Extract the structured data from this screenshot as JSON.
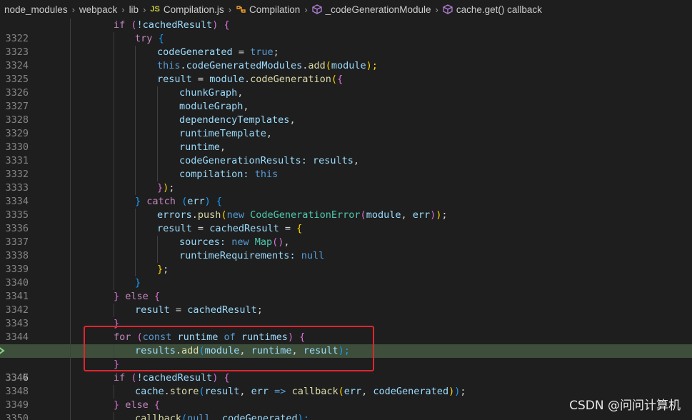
{
  "breadcrumb": {
    "items": [
      "node_modules",
      "webpack",
      "lib",
      "Compilation.js",
      "Compilation",
      "_codeGenerationModule",
      "cache.get() callback"
    ],
    "js_badge": "JS"
  },
  "editor": {
    "active_line": "3346",
    "highlight_color": "#3d4f3a",
    "annotation_box_color": "#e0262e",
    "line_numbers": [
      "3322",
      "3323",
      "3324",
      "3325",
      "3326",
      "3327",
      "3328",
      "3329",
      "3330",
      "3331",
      "3332",
      "3333",
      "3334",
      "3335",
      "3336",
      "3337",
      "3338",
      "3339",
      "3340",
      "3341",
      "3342",
      "3343",
      "3344",
      "3345",
      "3346",
      "3347",
      "3348",
      "3349",
      "3350",
      "3351"
    ],
    "tokens": {
      "l3322": [
        "if",
        "(",
        "!cachedResult",
        ")",
        "{"
      ],
      "l3323": [
        "try",
        "{"
      ],
      "l3324": [
        "codeGenerated",
        "=",
        "true",
        ";"
      ],
      "l3325": [
        "this",
        ".",
        "codeGeneratedModules",
        ".",
        "add",
        "(",
        "module",
        ");"
      ],
      "l3326": [
        "result",
        "=",
        "module",
        ".",
        "codeGeneration",
        "(",
        "{"
      ],
      "l3327": [
        "chunkGraph",
        ","
      ],
      "l3328": [
        "moduleGraph",
        ","
      ],
      "l3329": [
        "dependencyTemplates",
        ","
      ],
      "l3330": [
        "runtimeTemplate",
        ","
      ],
      "l3331": [
        "runtime",
        ","
      ],
      "l3332": [
        "codeGenerationResults",
        ":",
        "results",
        ","
      ],
      "l3333": [
        "compilation",
        ":",
        "this"
      ],
      "l3334": [
        "}",
        ")",
        ";"
      ],
      "l3335": [
        "}",
        "catch",
        "(",
        "err",
        ")",
        "{"
      ],
      "l3336": [
        "errors",
        ".",
        "push",
        "(",
        "new",
        "CodeGenerationError",
        "(",
        "module",
        ",",
        "err",
        ")",
        ")",
        ";"
      ],
      "l3337": [
        "result",
        "=",
        "cachedResult",
        "=",
        "{"
      ],
      "l3338": [
        "sources",
        ":",
        "new",
        "Map",
        "()",
        ","
      ],
      "l3339": [
        "runtimeRequirements",
        ":",
        "null"
      ],
      "l3340": [
        "}",
        ";"
      ],
      "l3341": [
        "}"
      ],
      "l3342": [
        "}",
        "else",
        "{"
      ],
      "l3343": [
        "result",
        "=",
        "cachedResult",
        ";"
      ],
      "l3344": [
        "}"
      ],
      "l3345": [
        "for",
        "(",
        "const",
        "runtime",
        "of",
        "runtimes",
        ")",
        "{"
      ],
      "l3346": [
        "results",
        ".",
        "add",
        "(",
        "module",
        ",",
        "runtime",
        ",",
        "result",
        ");"
      ],
      "l3347": [
        "}"
      ],
      "l3348": [
        "if",
        "(",
        "!cachedResult",
        ")",
        "{"
      ],
      "l3349": [
        "cache",
        ".",
        "store",
        "(",
        "result",
        ",",
        "err",
        "=>",
        "callback",
        "(",
        "err",
        ",",
        "codeGenerated",
        ")",
        ")",
        ";"
      ],
      "l3350": [
        "}",
        "else",
        "{"
      ],
      "l3351": [
        "callback",
        "(",
        "null",
        ",",
        "codeGenerated",
        ");"
      ]
    }
  },
  "watermark": "CSDN @问问计算机"
}
